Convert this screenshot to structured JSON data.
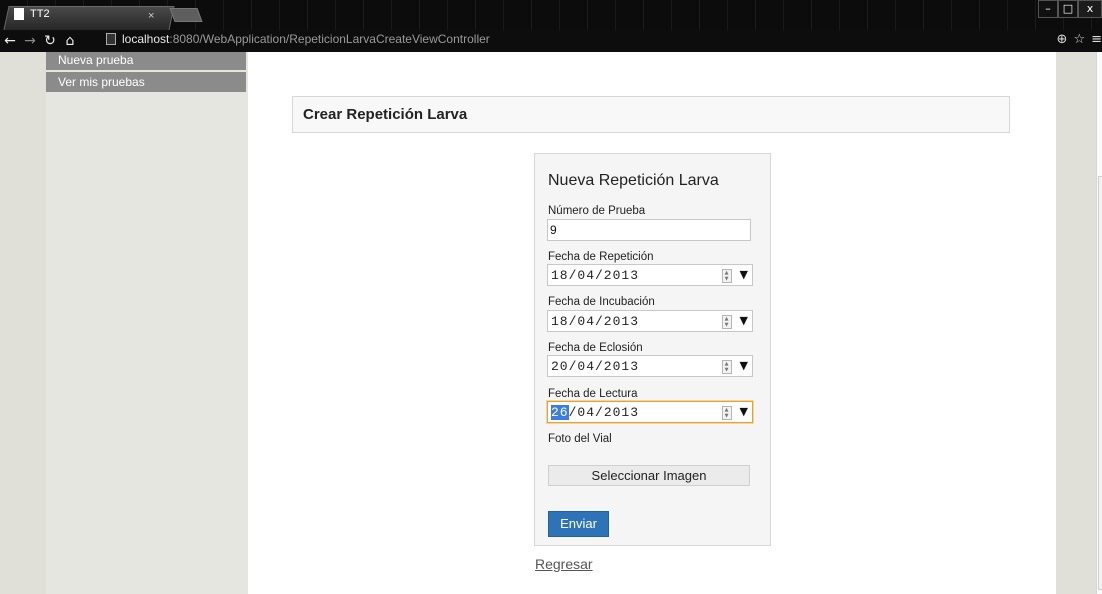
{
  "browser": {
    "tab_title": "TT2",
    "tab_close": "×",
    "url_host": "localhost",
    "url_rest": ":8080/WebApplication/RepeticionLarvaCreateViewController",
    "win_minimize": "–",
    "win_maximize": "□",
    "win_close": "x",
    "icons": [
      "back-icon",
      "forward-icon",
      "reload-icon",
      "home-icon",
      "page-icon",
      "zoom-icon",
      "star-icon",
      "menu-icon"
    ]
  },
  "sidebar": {
    "items": [
      {
        "label": "Nueva prueba"
      },
      {
        "label": "Ver mis pruebas"
      }
    ]
  },
  "header": {
    "title": "Crear Repetición Larva"
  },
  "form": {
    "title": "Nueva Repetición Larva",
    "numero_label": "Número de Prueba",
    "numero_value": "9",
    "fecha_repeticion_label": "Fecha de Repetición",
    "fecha_repeticion_value": "18/04/2013",
    "fecha_incubacion_label": "Fecha de Incubación",
    "fecha_incubacion_value": "18/04/2013",
    "fecha_eclosion_label": "Fecha de Eclosión",
    "fecha_eclosion_value": "20/04/2013",
    "fecha_lectura_label": "Fecha de Lectura",
    "fecha_lectura_day": "26",
    "fecha_lectura_rest": "/04/2013",
    "foto_label": "Foto del Vial",
    "file_button": "Seleccionar Imagen",
    "submit_button": "Enviar"
  },
  "back_link": "Regresar",
  "colors": {
    "accent": "#2d73b7",
    "sidebar_item": "#8b8b8b",
    "focus_border": "#e3a23f",
    "selection": "#3b7de0"
  }
}
